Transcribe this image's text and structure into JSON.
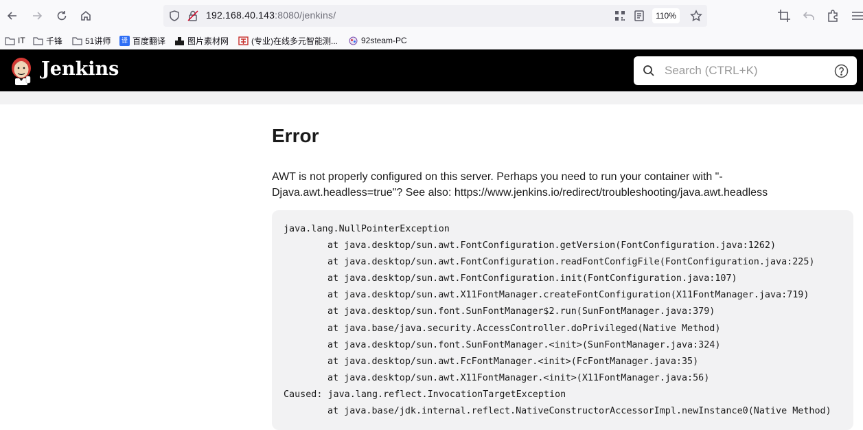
{
  "browser": {
    "url_host": "192.168.40.143",
    "url_rest": ":8080/jenkins/",
    "zoom": "110%"
  },
  "bookmarks": [
    {
      "label": "IT",
      "icon": "folder-icon"
    },
    {
      "label": "千锋",
      "icon": "folder-icon"
    },
    {
      "label": "51讲师",
      "icon": "folder-icon"
    },
    {
      "label": "百度翻译",
      "icon": "translate-icon"
    },
    {
      "label": "图片素材网",
      "icon": "image-site-icon"
    },
    {
      "label": "(专业)在线多元智能测...",
      "icon": "test-site-icon"
    },
    {
      "label": "92steam-PC",
      "icon": "steam-icon"
    }
  ],
  "jenkins": {
    "title": "Jenkins",
    "search_placeholder": "Search (CTRL+K)"
  },
  "error": {
    "title": "Error",
    "message": "AWT is not properly configured on this server. Perhaps you need to run your container with \"-Djava.awt.headless=true\"? See also: https://www.jenkins.io/redirect/troubleshooting/java.awt.headless",
    "trace": [
      {
        "text": "java.lang.NullPointerException",
        "indent": false
      },
      {
        "text": "at java.desktop/sun.awt.FontConfiguration.getVersion(FontConfiguration.java:1262)",
        "indent": true
      },
      {
        "text": "at java.desktop/sun.awt.FontConfiguration.readFontConfigFile(FontConfiguration.java:225)",
        "indent": true
      },
      {
        "text": "at java.desktop/sun.awt.FontConfiguration.init(FontConfiguration.java:107)",
        "indent": true
      },
      {
        "text": "at java.desktop/sun.awt.X11FontManager.createFontConfiguration(X11FontManager.java:719)",
        "indent": true
      },
      {
        "text": "at java.desktop/sun.font.SunFontManager$2.run(SunFontManager.java:379)",
        "indent": true
      },
      {
        "text": "at java.base/java.security.AccessController.doPrivileged(Native Method)",
        "indent": true
      },
      {
        "text": "at java.desktop/sun.font.SunFontManager.<init>(SunFontManager.java:324)",
        "indent": true
      },
      {
        "text": "at java.desktop/sun.awt.FcFontManager.<init>(FcFontManager.java:35)",
        "indent": true
      },
      {
        "text": "at java.desktop/sun.awt.X11FontManager.<init>(X11FontManager.java:56)",
        "indent": true
      },
      {
        "text": "Caused: java.lang.reflect.InvocationTargetException",
        "indent": false,
        "caused": true
      },
      {
        "text": "at java.base/jdk.internal.reflect.NativeConstructorAccessorImpl.newInstance0(Native Method)",
        "indent": true
      }
    ]
  }
}
